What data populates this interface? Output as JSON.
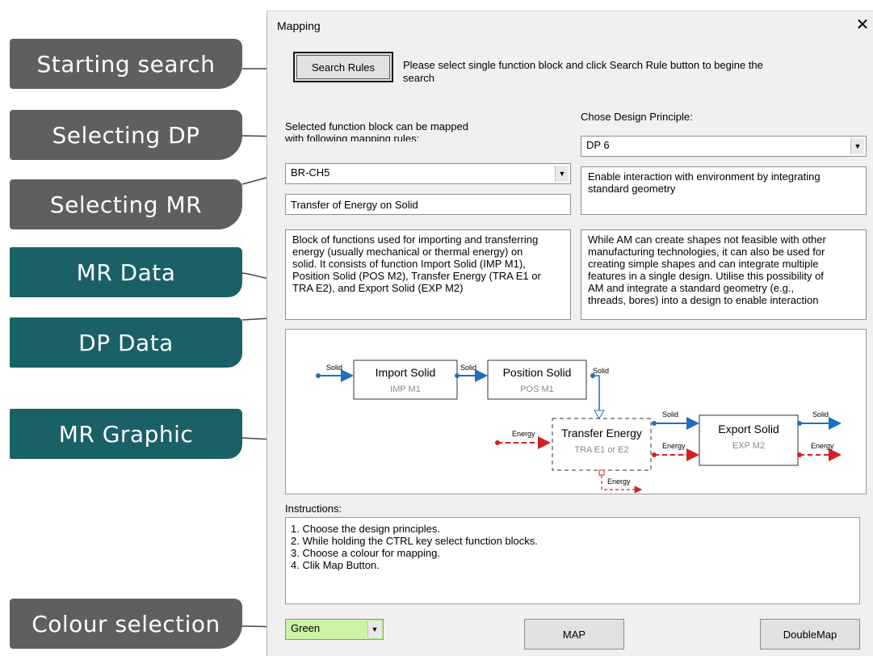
{
  "callouts": {
    "starting_search": "Starting search",
    "selecting_dp": "Selecting DP",
    "selecting_mr": "Selecting MR",
    "mr_data": "MR Data",
    "dp_data": "DP Data",
    "mr_graphic": "MR Graphic",
    "colour_selection": "Colour selection"
  },
  "dialog": {
    "title": "Mapping",
    "close_symbol": "✕",
    "search_button": "Search Rules",
    "search_hint_1": "Please select single function block and click Search Rule button to begine the",
    "search_hint_2": "search",
    "mr_label_1": "Selected function block can be mapped",
    "mr_label_2": "with following mapping rules;",
    "dp_label": "Chose Design Principle:",
    "dp_select": "DP 6",
    "mr_select": "BR-CH5",
    "mr_name": "Transfer of Energy on Solid",
    "dp_desc_1": "Enable interaction with environment by integrating",
    "dp_desc_2": "standard geometry",
    "mr_data_lines": [
      "Block of functions used for importing and transferring",
      "energy (usually mechanical or thermal energy) on",
      "solid. It consists of function Import Solid (IMP M1),",
      "Position Solid (POS M2), Transfer Energy (TRA E1 or",
      "TRA E2), and Export Solid (EXP M2)"
    ],
    "dp_data_lines": [
      "While AM can create shapes not feasible with other",
      "manufacturing technologies, it can also be used for",
      "creating simple shapes and can integrate multiple",
      "features in a single design. Utilise this possibility of",
      "AM and integrate a standard geometry (e.g.,",
      "threads, bores) into a design to enable interaction"
    ],
    "instructions_label": "Instructions:",
    "instructions": [
      "1. Choose the design principles.",
      "2. While holding the CTRL key select function blocks.",
      "3. Choose a colour for mapping.",
      "4. Clik Map Button."
    ],
    "colour_select": "Green",
    "colour_hex": "#ccf2a6",
    "map_button": "MAP",
    "doublemap_button": "DoubleMap"
  },
  "diagram": {
    "blocks": [
      {
        "title": "Import Solid",
        "code": "IMP M1"
      },
      {
        "title": "Position Solid",
        "code": "POS M1"
      },
      {
        "title": "Transfer Energy",
        "code": "TRA E1 or E2"
      },
      {
        "title": "Export Solid",
        "code": "EXP M2"
      }
    ],
    "flow_solid": "Solid",
    "flow_energy": "Energy",
    "solid_color": "#1f6fc0",
    "energy_color": "#d42020"
  }
}
